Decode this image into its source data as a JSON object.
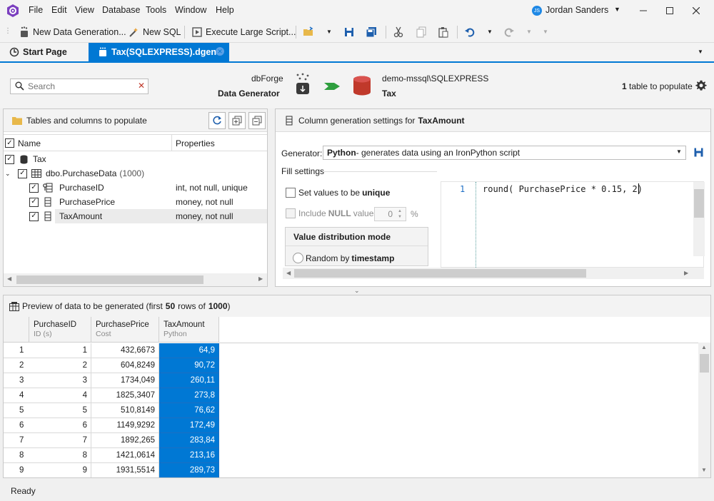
{
  "menu": {
    "items": [
      "File",
      "Edit",
      "View",
      "Database",
      "Tools",
      "Window",
      "Help"
    ],
    "user_initials": "JS",
    "user_name": "Jordan Sanders"
  },
  "toolbar": {
    "new_data_generation": "New Data Generation...",
    "new_sql": "New SQL",
    "execute_large_script": "Execute Large Script..."
  },
  "tabs": {
    "start_page": "Start Page",
    "document": "Tax(SQLEXPRESS).dgen*"
  },
  "header": {
    "search_placeholder": "Search",
    "product_line1": "dbForge",
    "product_line2": "Data Generator",
    "connection": "demo-mssql\\SQLEXPRESS",
    "database": "Tax",
    "tables_count": "1",
    "tables_label": "table to populate"
  },
  "left_panel": {
    "title": "Tables and columns to populate",
    "col_name": "Name",
    "col_properties": "Properties",
    "db_name": "Tax",
    "table_name": "dbo.PurchaseData",
    "table_rows": "(1000)",
    "columns": [
      {
        "name": "PurchaseID",
        "props": "int, not null, unique"
      },
      {
        "name": "PurchasePrice",
        "props": "money, not null"
      },
      {
        "name": "TaxAmount",
        "props": "money, not null"
      }
    ]
  },
  "right_panel": {
    "title_prefix": "Column generation settings for",
    "title_column": "TaxAmount",
    "generator_label": "Generator:",
    "generator_name": "Python",
    "generator_desc": " - generates data using an IronPython script",
    "fill_settings": "Fill settings",
    "unique_prefix": "Set values to be",
    "unique_bold": "unique",
    "null_prefix": "Include",
    "null_bold": "NULL",
    "null_suffix": "values",
    "null_value": "0",
    "null_unit": "%",
    "distribution_title": "Value distribution mode",
    "random_prefix": "Random by",
    "random_bold": "timestamp",
    "line_number": "1",
    "script": "round( PurchasePrice * 0.15, 2)"
  },
  "preview": {
    "prefix": "Preview of data to be generated (first",
    "first_count": "50",
    "middle": "rows of",
    "total": "1000",
    "suffix": ")",
    "columns": [
      {
        "name": "PurchaseID",
        "sub": "ID (s)"
      },
      {
        "name": "PurchasePrice",
        "sub": "Cost"
      },
      {
        "name": "TaxAmount",
        "sub": "Python"
      }
    ],
    "rows": [
      [
        "1",
        "1",
        "432,6673",
        "64,9"
      ],
      [
        "2",
        "2",
        "604,8249",
        "90,72"
      ],
      [
        "3",
        "3",
        "1734,049",
        "260,11"
      ],
      [
        "4",
        "4",
        "1825,3407",
        "273,8"
      ],
      [
        "5",
        "5",
        "510,8149",
        "76,62"
      ],
      [
        "6",
        "6",
        "1149,9292",
        "172,49"
      ],
      [
        "7",
        "7",
        "1892,265",
        "283,84"
      ],
      [
        "8",
        "8",
        "1421,0614",
        "213,16"
      ],
      [
        "9",
        "9",
        "1931,5514",
        "289,73"
      ]
    ]
  },
  "status": {
    "text": "Ready"
  },
  "colors": {
    "accent": "#0078d4",
    "db_red": "#c0392b",
    "arrow_green": "#2e9e3e"
  }
}
